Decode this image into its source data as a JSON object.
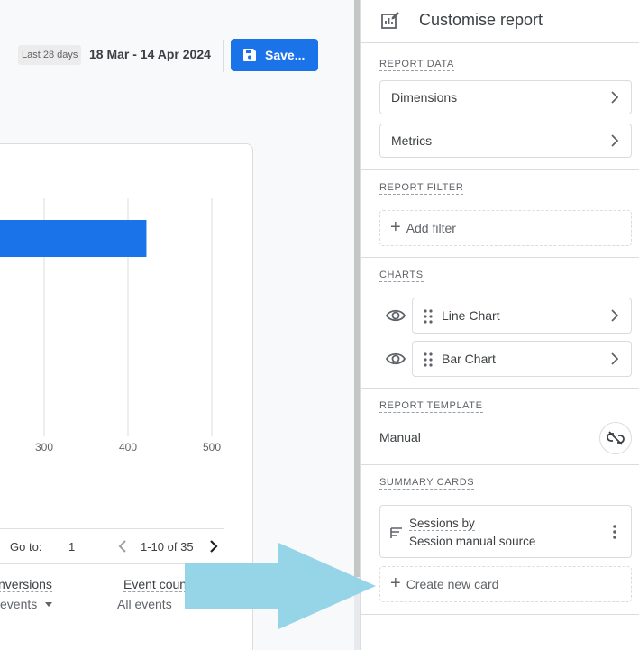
{
  "header": {
    "date_label_small": "Last 28 days",
    "date_range": "18 Mar - 14 Apr 2024",
    "save_label": "Save..."
  },
  "chart_data": {
    "type": "bar",
    "orientation": "horizontal",
    "categories": [
      ""
    ],
    "values": [
      422
    ],
    "xticks": [
      "300",
      "400",
      "500"
    ],
    "xtick_values": [
      300,
      400,
      500
    ],
    "xlim": [
      0,
      500
    ],
    "bar_color": "#1a73e8"
  },
  "pager": {
    "goto_label": "Go to:",
    "goto_value": "1",
    "page_range": "1-10 of 35"
  },
  "table": {
    "columns": [
      {
        "header": "nversions",
        "filter": "events"
      },
      {
        "header": "Event count",
        "filter": "All events"
      }
    ]
  },
  "panel": {
    "title": "Customise report",
    "report_data": {
      "label": "REPORT DATA",
      "items": [
        {
          "label": "Dimensions"
        },
        {
          "label": "Metrics"
        }
      ]
    },
    "report_filter": {
      "label": "REPORT FILTER",
      "add_label": "Add filter"
    },
    "charts": {
      "label": "CHARTS",
      "items": [
        {
          "label": "Line Chart"
        },
        {
          "label": "Bar Chart"
        }
      ]
    },
    "report_template": {
      "label": "REPORT TEMPLATE",
      "value": "Manual"
    },
    "summary_cards": {
      "label": "SUMMARY CARDS",
      "card_line1": "Sessions by",
      "card_line2": "Session manual source",
      "create_label": "Create new card"
    }
  },
  "colors": {
    "accent": "#1a73e8",
    "callout_arrow": "#8fd3e6"
  }
}
